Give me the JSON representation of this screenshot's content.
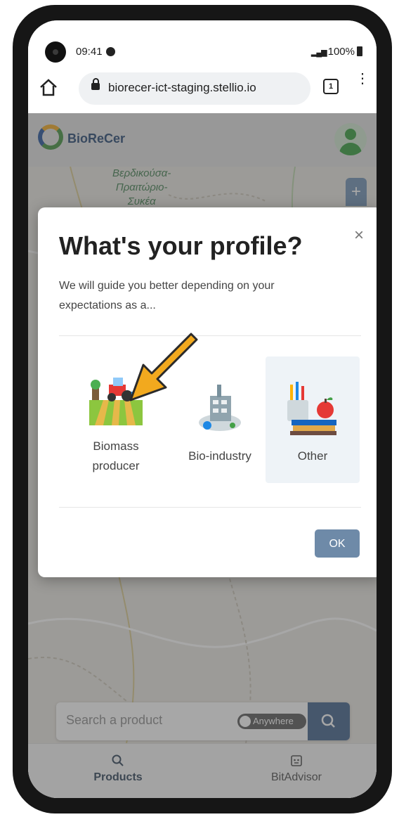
{
  "status_bar": {
    "time": "09:41",
    "battery": "100%"
  },
  "browser": {
    "url": "biorecer-ict-staging.stellio.io",
    "tab_count": "1"
  },
  "app": {
    "brand": "BioReCer"
  },
  "map": {
    "place_label_line1": "Βερδικούσα-",
    "place_label_line2": "Πραιτώριο-",
    "place_label_line3": "Συκέα"
  },
  "modal": {
    "title": "What's your profile?",
    "subtitle": "We will guide you better depending on your expectations as a...",
    "close_symbol": "×",
    "options": [
      {
        "label_line1": "Biomass",
        "label_line2": "producer",
        "icon": "tractor-field-icon"
      },
      {
        "label_line1": "Bio-industry",
        "icon": "factory-icon"
      },
      {
        "label_line1": "Other",
        "icon": "books-apple-icon",
        "selected": true
      }
    ],
    "ok_label": "OK"
  },
  "search": {
    "placeholder": "Search a product",
    "toggle_label": "Anywhere"
  },
  "bottom_nav": {
    "products_label": "Products",
    "bitadvisor_label": "BitAdvisor"
  },
  "colors": {
    "accent": "#3c5f88",
    "ok_button": "#6e8aa8",
    "arrow": "#f2a91e"
  }
}
